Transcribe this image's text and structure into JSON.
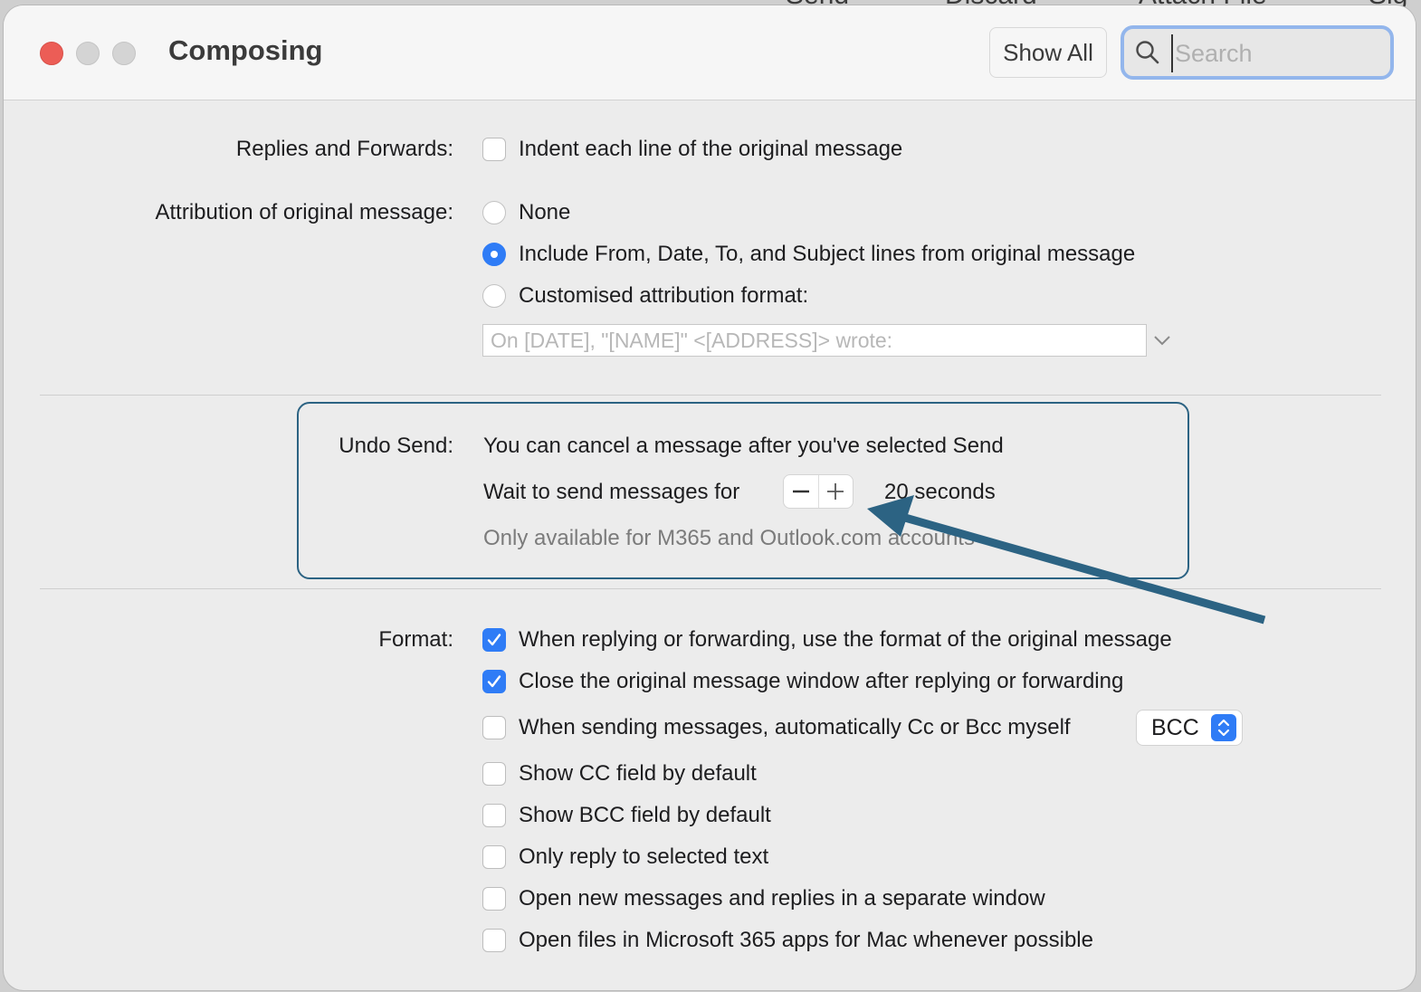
{
  "background_toolbar": {
    "send": "Send",
    "discard": "Discard",
    "attach_file": "Attach File",
    "sig": "Sig"
  },
  "window": {
    "title": "Composing",
    "show_all": "Show All",
    "search_placeholder": "Search"
  },
  "replies": {
    "label": "Replies and Forwards:",
    "indent_option": {
      "label": "Indent each line of the original message",
      "checked": false
    }
  },
  "attribution": {
    "label": "Attribution of original message:",
    "options": [
      {
        "label": "None",
        "selected": false
      },
      {
        "label": "Include From, Date, To, and Subject lines from original message",
        "selected": true
      },
      {
        "label": "Customised attribution format:",
        "selected": false
      }
    ],
    "format_value": "On [DATE], \"[NAME]\" <[ADDRESS]> wrote:"
  },
  "undo_send": {
    "label": "Undo Send:",
    "description": "You can cancel a message after you've selected Send",
    "wait_label": "Wait to send messages for",
    "wait_value": "20 seconds",
    "note": "Only available for M365 and Outlook.com accounts"
  },
  "format": {
    "label": "Format:",
    "options": [
      {
        "label": "When replying or forwarding, use the format of the original message",
        "checked": true
      },
      {
        "label": "Close the original message window after replying or forwarding",
        "checked": true
      },
      {
        "label": "When sending messages, automatically Cc or Bcc myself",
        "checked": false
      },
      {
        "label": "Show CC field by default",
        "checked": false
      },
      {
        "label": "Show BCC field by default",
        "checked": false
      },
      {
        "label": "Only reply to selected text",
        "checked": false
      },
      {
        "label": "Open new messages and replies in a separate window",
        "checked": false
      },
      {
        "label": "Open files in Microsoft 365 apps for Mac whenever possible",
        "checked": false
      }
    ],
    "cc_bcc_value": "BCC"
  },
  "colors": {
    "accent": "#2f7cf6",
    "annotation": "#2c6383",
    "close_light": "#ec5d56"
  }
}
